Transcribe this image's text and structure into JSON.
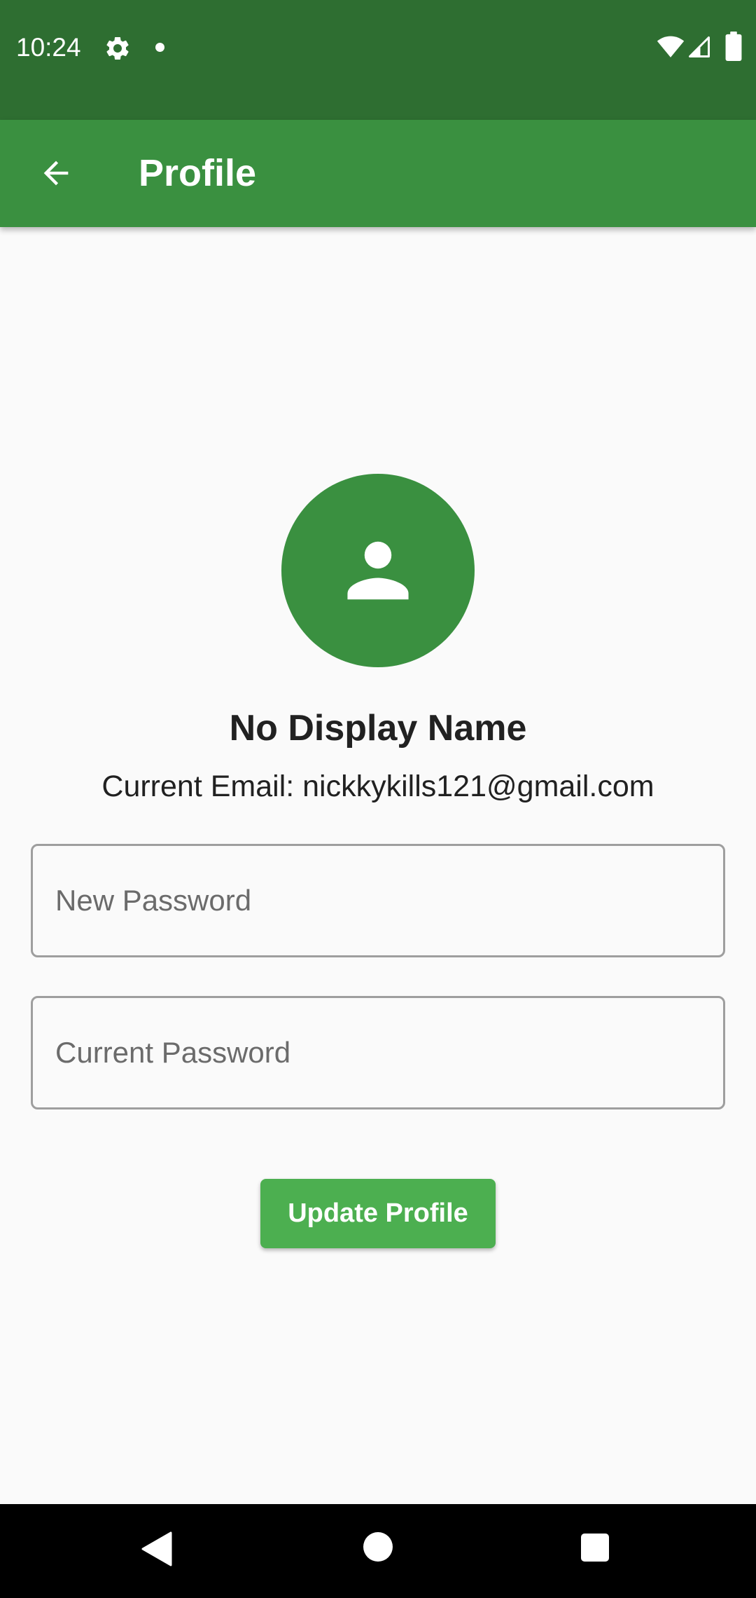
{
  "status_bar": {
    "time": "10:24",
    "icons": [
      "settings-icon",
      "notification-dot-icon",
      "wifi-icon",
      "cell-signal-icon",
      "battery-icon"
    ]
  },
  "app_bar": {
    "title": "Profile",
    "back_icon": "arrow-back-icon",
    "color": "#3a9040"
  },
  "profile": {
    "avatar_icon": "person-icon",
    "display_name": "No Display Name",
    "email_line": "Current Email: nickkykills121@gmail.com"
  },
  "form": {
    "new_password_placeholder": "New Password",
    "new_password_value": "",
    "current_password_placeholder": "Current Password",
    "current_password_value": "",
    "submit_label": "Update Profile"
  },
  "nav_bar": {
    "icons": [
      "nav-back-icon",
      "nav-home-icon",
      "nav-recents-icon"
    ]
  },
  "colors": {
    "status_bar": "#2e6e31",
    "primary": "#3a9040",
    "button": "#4caf50",
    "background": "#fafafa"
  }
}
